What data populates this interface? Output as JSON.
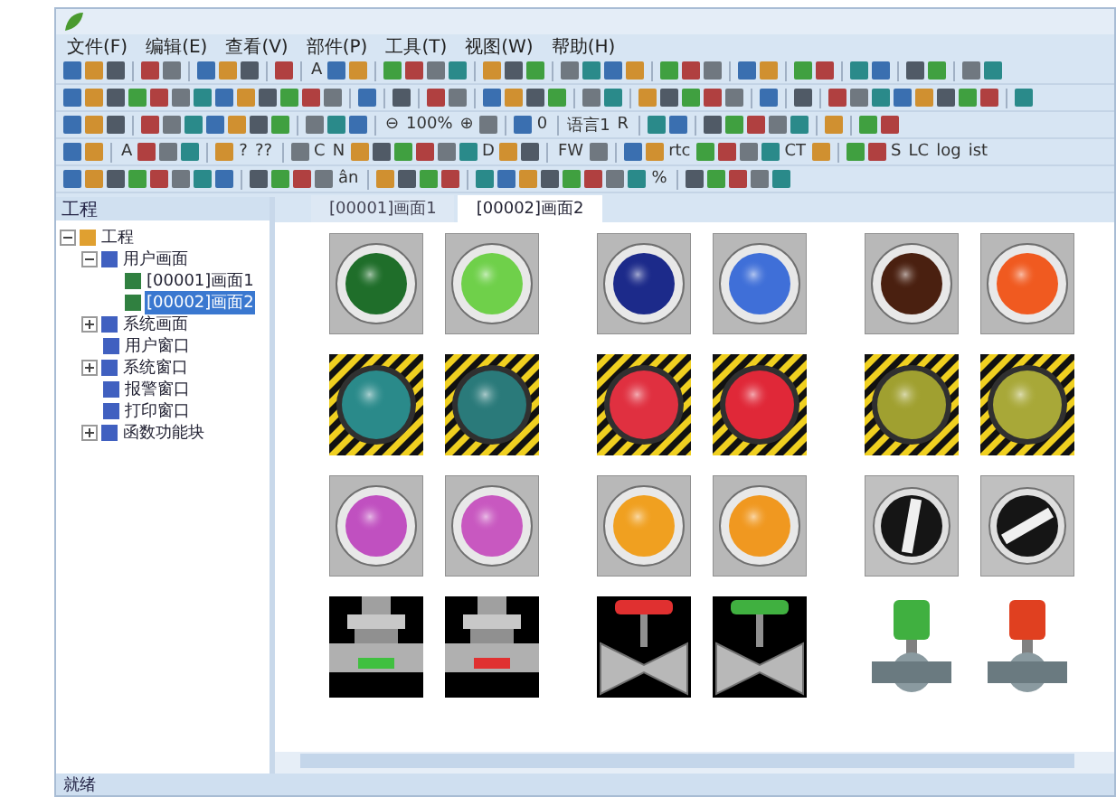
{
  "menu": [
    "文件(F)",
    "编辑(E)",
    "查看(V)",
    "部件(P)",
    "工具(T)",
    "视图(W)",
    "帮助(H)"
  ],
  "toolbars": [
    [
      {
        "kind": "icon"
      },
      {
        "kind": "icon"
      },
      {
        "kind": "icon"
      },
      {
        "kind": "separator"
      },
      {
        "kind": "icon"
      },
      {
        "kind": "icon"
      },
      {
        "kind": "separator"
      },
      {
        "kind": "icon"
      },
      {
        "kind": "icon"
      },
      {
        "kind": "icon"
      },
      {
        "kind": "separator"
      },
      {
        "kind": "icon"
      },
      {
        "kind": "separator"
      },
      {
        "kind": "text",
        "label": "A"
      },
      {
        "kind": "icon"
      },
      {
        "kind": "icon"
      },
      {
        "kind": "separator"
      },
      {
        "kind": "icon"
      },
      {
        "kind": "icon"
      },
      {
        "kind": "icon"
      },
      {
        "kind": "icon"
      },
      {
        "kind": "separator"
      },
      {
        "kind": "icon"
      },
      {
        "kind": "icon"
      },
      {
        "kind": "icon"
      },
      {
        "kind": "separator"
      },
      {
        "kind": "icon"
      },
      {
        "kind": "icon"
      },
      {
        "kind": "icon"
      },
      {
        "kind": "icon"
      },
      {
        "kind": "separator"
      },
      {
        "kind": "icon"
      },
      {
        "kind": "icon"
      },
      {
        "kind": "icon"
      },
      {
        "kind": "separator"
      },
      {
        "kind": "icon"
      },
      {
        "kind": "icon"
      },
      {
        "kind": "separator"
      },
      {
        "kind": "icon"
      },
      {
        "kind": "icon"
      },
      {
        "kind": "separator"
      },
      {
        "kind": "icon"
      },
      {
        "kind": "icon"
      },
      {
        "kind": "separator"
      },
      {
        "kind": "icon"
      },
      {
        "kind": "icon"
      },
      {
        "kind": "separator"
      },
      {
        "kind": "icon"
      },
      {
        "kind": "icon"
      }
    ],
    [
      {
        "kind": "icon"
      },
      {
        "kind": "icon"
      },
      {
        "kind": "icon"
      },
      {
        "kind": "icon"
      },
      {
        "kind": "icon"
      },
      {
        "kind": "icon"
      },
      {
        "kind": "icon"
      },
      {
        "kind": "icon"
      },
      {
        "kind": "icon"
      },
      {
        "kind": "icon"
      },
      {
        "kind": "icon"
      },
      {
        "kind": "icon"
      },
      {
        "kind": "icon"
      },
      {
        "kind": "separator"
      },
      {
        "kind": "icon"
      },
      {
        "kind": "separator"
      },
      {
        "kind": "icon"
      },
      {
        "kind": "separator"
      },
      {
        "kind": "icon"
      },
      {
        "kind": "icon"
      },
      {
        "kind": "separator"
      },
      {
        "kind": "icon"
      },
      {
        "kind": "icon"
      },
      {
        "kind": "icon"
      },
      {
        "kind": "icon"
      },
      {
        "kind": "separator"
      },
      {
        "kind": "icon"
      },
      {
        "kind": "icon"
      },
      {
        "kind": "separator"
      },
      {
        "kind": "icon"
      },
      {
        "kind": "icon"
      },
      {
        "kind": "icon"
      },
      {
        "kind": "icon"
      },
      {
        "kind": "icon"
      },
      {
        "kind": "separator"
      },
      {
        "kind": "icon"
      },
      {
        "kind": "separator"
      },
      {
        "kind": "icon"
      },
      {
        "kind": "separator"
      },
      {
        "kind": "icon"
      },
      {
        "kind": "icon"
      },
      {
        "kind": "icon"
      },
      {
        "kind": "icon"
      },
      {
        "kind": "icon"
      },
      {
        "kind": "icon"
      },
      {
        "kind": "icon"
      },
      {
        "kind": "icon"
      },
      {
        "kind": "separator"
      },
      {
        "kind": "icon"
      }
    ],
    [
      {
        "kind": "icon"
      },
      {
        "kind": "icon"
      },
      {
        "kind": "icon"
      },
      {
        "kind": "separator"
      },
      {
        "kind": "icon"
      },
      {
        "kind": "icon"
      },
      {
        "kind": "icon"
      },
      {
        "kind": "icon"
      },
      {
        "kind": "icon"
      },
      {
        "kind": "icon"
      },
      {
        "kind": "icon"
      },
      {
        "kind": "separator"
      },
      {
        "kind": "icon"
      },
      {
        "kind": "icon"
      },
      {
        "kind": "icon"
      },
      {
        "kind": "separator"
      },
      {
        "kind": "text",
        "label": "⊖"
      },
      {
        "kind": "text",
        "label": "100%"
      },
      {
        "kind": "text",
        "label": "⊕"
      },
      {
        "kind": "icon"
      },
      {
        "kind": "separator"
      },
      {
        "kind": "icon"
      },
      {
        "kind": "text",
        "label": "0"
      },
      {
        "kind": "separator"
      },
      {
        "kind": "text",
        "label": "语言1"
      },
      {
        "kind": "text",
        "label": "R"
      },
      {
        "kind": "separator"
      },
      {
        "kind": "icon"
      },
      {
        "kind": "icon"
      },
      {
        "kind": "separator"
      },
      {
        "kind": "icon"
      },
      {
        "kind": "icon"
      },
      {
        "kind": "icon"
      },
      {
        "kind": "icon"
      },
      {
        "kind": "icon"
      },
      {
        "kind": "separator"
      },
      {
        "kind": "icon"
      },
      {
        "kind": "separator"
      },
      {
        "kind": "icon"
      },
      {
        "kind": "icon"
      }
    ],
    [
      {
        "kind": "icon"
      },
      {
        "kind": "icon"
      },
      {
        "kind": "separator"
      },
      {
        "kind": "text",
        "label": "A"
      },
      {
        "kind": "icon"
      },
      {
        "kind": "icon"
      },
      {
        "kind": "icon"
      },
      {
        "kind": "separator"
      },
      {
        "kind": "icon"
      },
      {
        "kind": "text",
        "label": "?"
      },
      {
        "kind": "text",
        "label": "??"
      },
      {
        "kind": "separator"
      },
      {
        "kind": "icon"
      },
      {
        "kind": "text",
        "label": "C"
      },
      {
        "kind": "text",
        "label": "N"
      },
      {
        "kind": "icon"
      },
      {
        "kind": "icon"
      },
      {
        "kind": "icon"
      },
      {
        "kind": "icon"
      },
      {
        "kind": "icon"
      },
      {
        "kind": "icon"
      },
      {
        "kind": "text",
        "label": "D"
      },
      {
        "kind": "icon"
      },
      {
        "kind": "icon"
      },
      {
        "kind": "separator"
      },
      {
        "kind": "text",
        "label": "FW"
      },
      {
        "kind": "icon"
      },
      {
        "kind": "separator"
      },
      {
        "kind": "icon"
      },
      {
        "kind": "icon"
      },
      {
        "kind": "text",
        "label": "rtc"
      },
      {
        "kind": "icon"
      },
      {
        "kind": "icon"
      },
      {
        "kind": "icon"
      },
      {
        "kind": "icon"
      },
      {
        "kind": "text",
        "label": "CT"
      },
      {
        "kind": "icon"
      },
      {
        "kind": "separator"
      },
      {
        "kind": "icon"
      },
      {
        "kind": "icon"
      },
      {
        "kind": "text",
        "label": "S"
      },
      {
        "kind": "text",
        "label": "LC"
      },
      {
        "kind": "text",
        "label": "log"
      },
      {
        "kind": "text",
        "label": "ist"
      }
    ],
    [
      {
        "kind": "icon"
      },
      {
        "kind": "icon"
      },
      {
        "kind": "icon"
      },
      {
        "kind": "icon"
      },
      {
        "kind": "icon"
      },
      {
        "kind": "icon"
      },
      {
        "kind": "icon"
      },
      {
        "kind": "icon"
      },
      {
        "kind": "separator"
      },
      {
        "kind": "icon"
      },
      {
        "kind": "icon"
      },
      {
        "kind": "icon"
      },
      {
        "kind": "icon"
      },
      {
        "kind": "text",
        "label": "ân"
      },
      {
        "kind": "separator"
      },
      {
        "kind": "icon"
      },
      {
        "kind": "icon"
      },
      {
        "kind": "icon"
      },
      {
        "kind": "icon"
      },
      {
        "kind": "separator"
      },
      {
        "kind": "icon"
      },
      {
        "kind": "icon"
      },
      {
        "kind": "icon"
      },
      {
        "kind": "icon"
      },
      {
        "kind": "icon"
      },
      {
        "kind": "icon"
      },
      {
        "kind": "icon"
      },
      {
        "kind": "icon"
      },
      {
        "kind": "text",
        "label": "%"
      },
      {
        "kind": "separator"
      },
      {
        "kind": "icon"
      },
      {
        "kind": "icon"
      },
      {
        "kind": "icon"
      },
      {
        "kind": "icon"
      },
      {
        "kind": "icon"
      }
    ]
  ],
  "panel": {
    "title": "工程"
  },
  "tree": [
    {
      "label": "工程",
      "expanded": true,
      "selected": false,
      "children": [
        {
          "label": "用户画面",
          "expanded": true,
          "selected": false,
          "children": [
            {
              "label": "[00001]画面1",
              "selected": false
            },
            {
              "label": "[00002]画面2",
              "selected": true
            }
          ]
        },
        {
          "label": "系统画面",
          "expanded": false,
          "selected": false
        },
        {
          "label": "用户窗口",
          "selected": false
        },
        {
          "label": "系统窗口",
          "expanded": false,
          "selected": false
        },
        {
          "label": "报警窗口",
          "selected": false
        },
        {
          "label": "打印窗口",
          "selected": false
        },
        {
          "label": "函数功能块",
          "expanded": false,
          "selected": false
        }
      ]
    }
  ],
  "tabs": [
    {
      "label": "[00001]画面1",
      "selected": false
    },
    {
      "label": "[00002]画面2",
      "selected": true
    }
  ],
  "widgets": [
    [
      {
        "kind": "lamp",
        "color": "#1f6e2a"
      },
      {
        "kind": "lamp",
        "color": "#6fd04a"
      },
      {
        "kind": "lamp",
        "color": "#1c2a8a"
      },
      {
        "kind": "lamp",
        "color": "#3f6fd8"
      },
      {
        "kind": "lamp",
        "color": "#4a2010"
      },
      {
        "kind": "lamp",
        "color": "#f05a20"
      }
    ],
    [
      {
        "kind": "hazard",
        "color": "#2a8a8a"
      },
      {
        "kind": "hazard",
        "color": "#2a7a7a"
      },
      {
        "kind": "hazard",
        "color": "#e03040"
      },
      {
        "kind": "hazard",
        "color": "#e02838"
      },
      {
        "kind": "hazard",
        "color": "#a0a030"
      },
      {
        "kind": "hazard",
        "color": "#a8a838"
      }
    ],
    [
      {
        "kind": "lamp",
        "color": "#c050c0"
      },
      {
        "kind": "lamp",
        "color": "#c858c0"
      },
      {
        "kind": "lamp",
        "color": "#f0a020"
      },
      {
        "kind": "lamp",
        "color": "#f09820"
      },
      {
        "kind": "selector",
        "on": false
      },
      {
        "kind": "selector",
        "on": true
      }
    ],
    [
      {
        "kind": "pipe",
        "color": "#40c040"
      },
      {
        "kind": "pipe",
        "color": "#e03030"
      },
      {
        "kind": "valve",
        "color": "#e03030"
      },
      {
        "kind": "valve",
        "color": "#40b040"
      },
      {
        "kind": "actuator",
        "color": "#40b040"
      },
      {
        "kind": "actuator",
        "color": "#e04020"
      }
    ]
  ],
  "status_bar": {
    "text": "就绪"
  }
}
